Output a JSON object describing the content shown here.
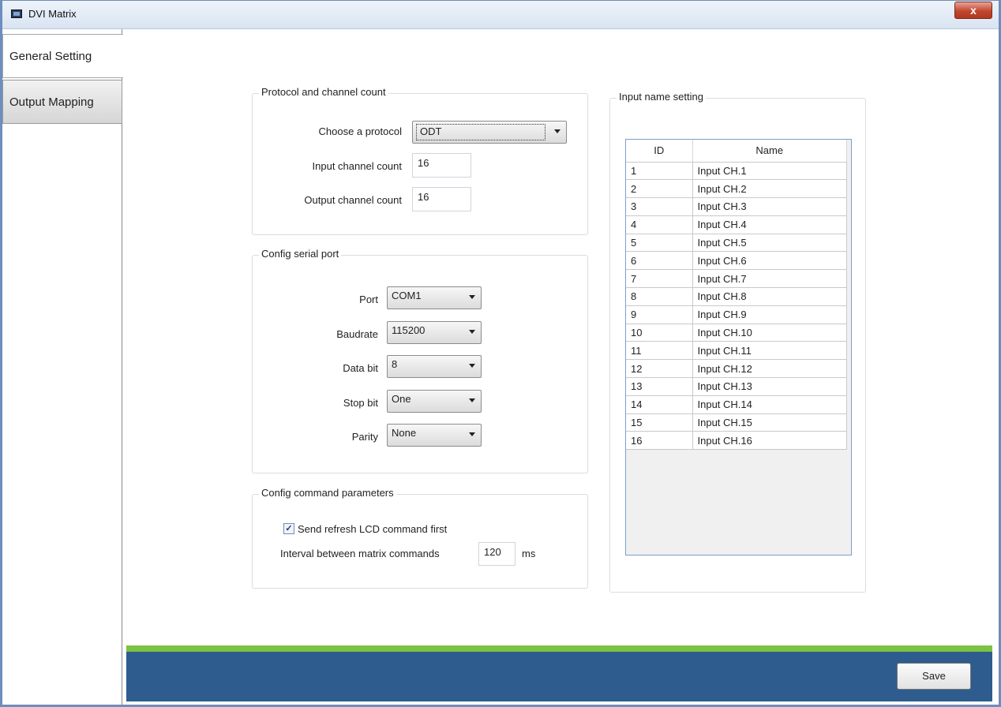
{
  "window": {
    "title": "DVI Matrix",
    "close_label": "x"
  },
  "sidebar": {
    "tabs": [
      {
        "label": "General Setting",
        "active": true
      },
      {
        "label": "Output Mapping",
        "active": false
      }
    ]
  },
  "protocol_group": {
    "title": "Protocol and channel count",
    "protocol_label": "Choose a protocol",
    "protocol_value": "ODT",
    "input_label": "Input channel count",
    "input_value": "16",
    "output_label": "Output channel count",
    "output_value": "16"
  },
  "serial_group": {
    "title": "Config serial port",
    "fields": [
      {
        "label": "Port",
        "value": "COM1"
      },
      {
        "label": "Baudrate",
        "value": "115200"
      },
      {
        "label": "Data bit",
        "value": "8"
      },
      {
        "label": "Stop bit",
        "value": "One"
      },
      {
        "label": "Parity",
        "value": "None"
      }
    ]
  },
  "command_group": {
    "title": "Config command parameters",
    "refresh_label": "Send refresh LCD command first",
    "refresh_checked": true,
    "interval_label": "Interval between matrix commands",
    "interval_value": "120",
    "interval_unit": "ms"
  },
  "input_names": {
    "title": "Input name setting",
    "columns": [
      "ID",
      "Name"
    ],
    "rows": [
      [
        "1",
        "Input CH.1"
      ],
      [
        "2",
        "Input CH.2"
      ],
      [
        "3",
        "Input CH.3"
      ],
      [
        "4",
        "Input CH.4"
      ],
      [
        "5",
        "Input CH.5"
      ],
      [
        "6",
        "Input CH.6"
      ],
      [
        "7",
        "Input CH.7"
      ],
      [
        "8",
        "Input CH.8"
      ],
      [
        "9",
        "Input CH.9"
      ],
      [
        "10",
        "Input CH.10"
      ],
      [
        "11",
        "Input CH.11"
      ],
      [
        "12",
        "Input CH.12"
      ],
      [
        "13",
        "Input CH.13"
      ],
      [
        "14",
        "Input CH.14"
      ],
      [
        "15",
        "Input CH.15"
      ],
      [
        "16",
        "Input CH.16"
      ]
    ]
  },
  "footer": {
    "save_label": "Save"
  },
  "colors": {
    "footer_green": "#7cc243",
    "footer_blue": "#2e5c8e",
    "grid_border": "#7d9fc7"
  }
}
